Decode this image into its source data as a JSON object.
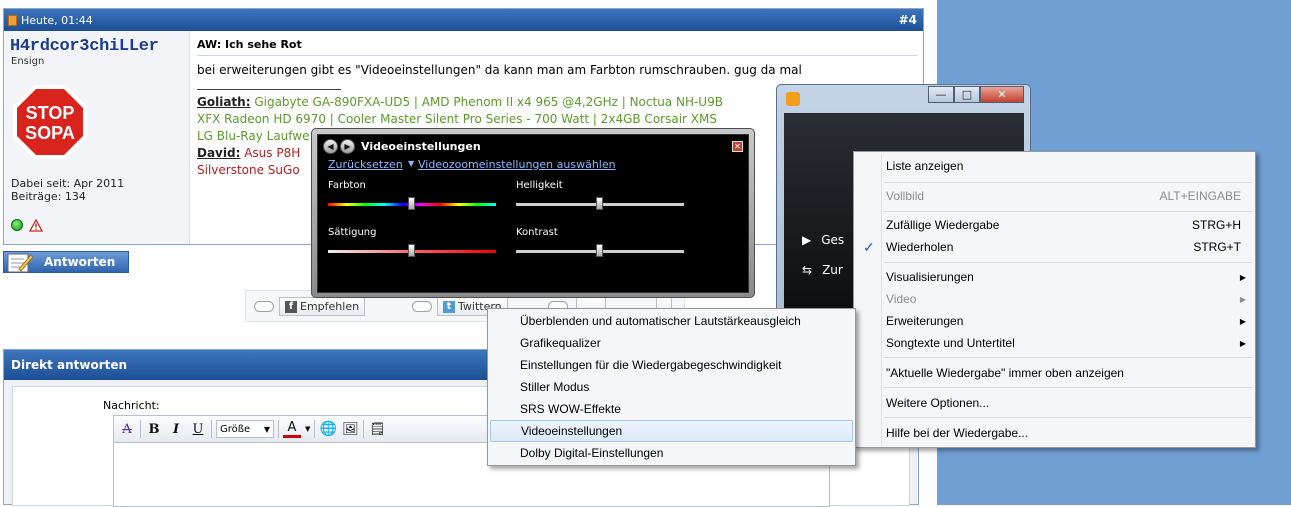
{
  "post": {
    "date": "Heute, 01:44",
    "number": "#4",
    "username": "H4rdcor3chiLLer",
    "rank": "Ensign",
    "avatar_text_1": "STOP",
    "avatar_text_2": "SOPA",
    "joined": "Dabei seit: Apr 2011",
    "posts": "Beiträge: 134",
    "title": "AW: Ich sehe Rot",
    "text": "bei erweiterungen gibt es \"Videoeinstellungen\" da kann man am Farbton rumschrauben. gug da mal",
    "sig": {
      "line1_label": "Goliath:",
      "line1_text": " Gigabyte GA-890FXA-UD5 | AMD Phenom II x4 965 @4,2GHz | Noctua NH-U9B",
      "line2_text": "XFX Radeon HD 6970 | Cooler Master Silent Pro Series - 700 Watt | 2x4GB Corsair XMS",
      "line3_text": "LG Blu-Ray Laufwe",
      "line4_label": "David:",
      "line4_text": " Asus P8H",
      "line5_text": "Silverstone SuGo"
    }
  },
  "reply_button": "Antworten",
  "share": {
    "recommend": "Empfehlen",
    "twitter": "Twittern"
  },
  "quick_reply": {
    "title": "Direkt antworten",
    "message_label": "Nachricht:",
    "size_select": "Größe"
  },
  "video_settings": {
    "title": "Videoeinstellungen",
    "reset": "Zurücksetzen",
    "zoom": "Videozoomeinstellungen auswählen",
    "hue": "Farbton",
    "brightness": "Helligkeit",
    "saturation": "Sättigung",
    "contrast": "Kontrast",
    "hue_level": 0.5,
    "brightness_level": 0.5,
    "saturation_level": 0.5,
    "contrast_level": 0.5
  },
  "player": {
    "item1": "Ges",
    "item2": "Zur"
  },
  "main_menu": [
    {
      "label": "Liste anzeigen"
    },
    {
      "label": "Vollbild",
      "shortcut": "ALT+EINGABE",
      "disabled": true
    },
    {
      "label": "Zufällige Wiedergabe",
      "shortcut": "STRG+H"
    },
    {
      "label": "Wiederholen",
      "shortcut": "STRG+T",
      "checked": true
    },
    {
      "label": "Visualisierungen",
      "submenu": true
    },
    {
      "label": "Video",
      "submenu": true,
      "disabled": true
    },
    {
      "label": "Erweiterungen",
      "submenu": true
    },
    {
      "label": "Songtexte und Untertitel",
      "submenu": true
    },
    {
      "label": "\"Aktuelle Wiedergabe\" immer oben anzeigen"
    },
    {
      "label": "Weitere Optionen..."
    },
    {
      "label": "Hilfe bei der Wiedergabe..."
    }
  ],
  "sub_menu": [
    {
      "label": "Überblenden und automatischer Lautstärkeausgleich"
    },
    {
      "label": "Grafikequalizer"
    },
    {
      "label": "Einstellungen für die Wiedergabegeschwindigkeit"
    },
    {
      "label": "Stiller Modus"
    },
    {
      "label": "SRS WOW-Effekte"
    },
    {
      "label": "Videoeinstellungen",
      "highlighted": true
    },
    {
      "label": "Dolby Digital-Einstellungen"
    }
  ]
}
